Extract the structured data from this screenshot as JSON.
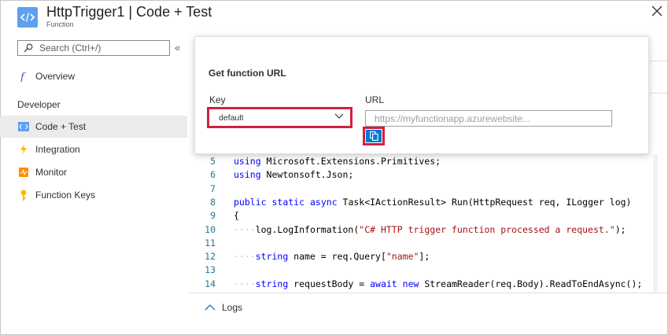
{
  "header": {
    "title": "HttpTrigger1 | Code + Test",
    "subtitle": "Function",
    "icon": "function-code-icon",
    "close_icon": "close-icon"
  },
  "sidebar": {
    "search": {
      "placeholder": "Search (Ctrl+/)",
      "value": ""
    },
    "collapse_glyph": "«",
    "items_top": [
      {
        "label": "Overview",
        "icon": "function-icon"
      }
    ],
    "section_label": "Developer",
    "items": [
      {
        "label": "Code + Test",
        "icon": "code-icon",
        "active": true
      },
      {
        "label": "Integration",
        "icon": "lightning-icon",
        "active": false
      },
      {
        "label": "Monitor",
        "icon": "monitor-icon",
        "active": false
      },
      {
        "label": "Function Keys",
        "icon": "key-icon",
        "active": false
      }
    ]
  },
  "popup": {
    "title": "Get function URL",
    "key_label": "Key",
    "key_value": "default",
    "url_label": "URL",
    "url_placeholder": "https://myfunctionapp.azurewebsite...",
    "highlight_color": "#d1213c",
    "copy_icon": "copy-icon"
  },
  "editor": {
    "lines": [
      {
        "n": "5",
        "html": "using Microsoft.Extensions.Primitives;"
      },
      {
        "n": "6",
        "html": "using Newtonsoft.Json;"
      },
      {
        "n": "7",
        "html": ""
      },
      {
        "n": "8",
        "html": "public static async Task<IActionResult> Run(HttpRequest req, ILogger log)"
      },
      {
        "n": "9",
        "html": "{"
      },
      {
        "n": "10",
        "html": "    log.LogInformation(\"C# HTTP trigger function processed a request.\");"
      },
      {
        "n": "11",
        "html": ""
      },
      {
        "n": "12",
        "html": "    string name = req.Query[\"name\"];"
      },
      {
        "n": "13",
        "html": ""
      },
      {
        "n": "14",
        "html": "    string requestBody = await new StreamReader(req.Body).ReadToEndAsync();"
      }
    ]
  },
  "logs": {
    "label": "Logs"
  },
  "colors": {
    "accent": "#0078d4",
    "keyword": "#0000ff",
    "string": "#a31515",
    "line_number": "#237893",
    "active_nav": "#edebe9"
  }
}
